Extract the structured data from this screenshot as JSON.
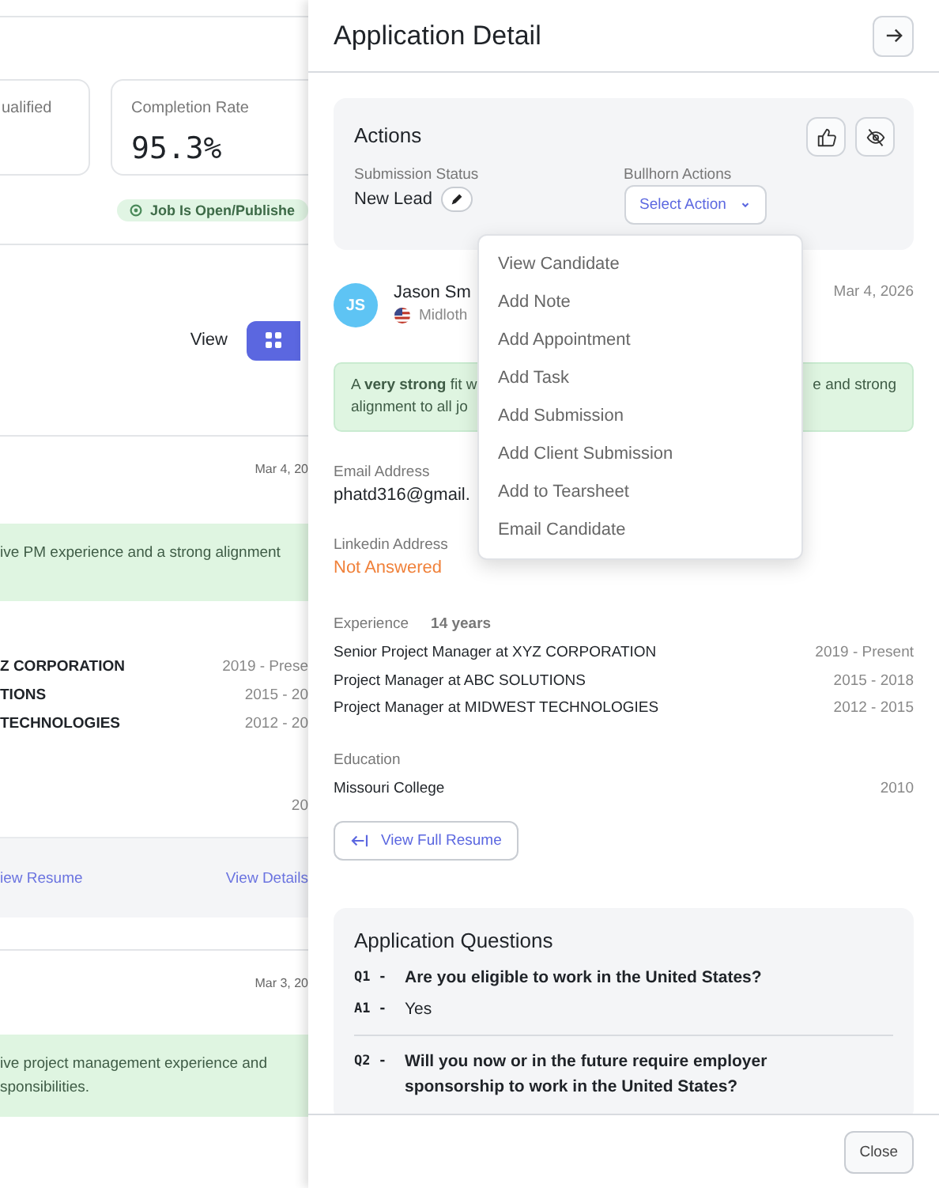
{
  "background_page": {
    "stats": [
      {
        "label": "ualified"
      },
      {
        "label": "Completion Rate",
        "value": "95.3%"
      }
    ],
    "status_badge": "Job Is Open/Publishe",
    "view_label": "View",
    "view_modes": [
      {
        "kind": "grid",
        "selected": true
      }
    ],
    "applications": [
      {
        "date": "Mar 4, 20",
        "summary_lines": [
          "ive PM experience and a strong alignment"
        ],
        "experience": [
          {
            "title": "Z CORPORATION",
            "years": "2019 - Prese"
          },
          {
            "title": "TIONS",
            "years": "2015 - 20"
          },
          {
            "title": "TECHNOLOGIES",
            "years": "2012 - 20"
          }
        ],
        "education_year": "20",
        "links": [
          "iew Resume",
          "View Details"
        ]
      },
      {
        "date": "Mar 3, 20",
        "summary_lines": [
          "ive project management experience and",
          "sponsibilities."
        ]
      }
    ]
  },
  "drawer": {
    "title": "Application Detail",
    "actions": {
      "title": "Actions",
      "status_label": "Submission Status",
      "status": "New Lead",
      "bullhorn_label": "Bullhorn Actions",
      "select_label": "Select Action"
    },
    "menu": [
      "View Candidate",
      "Add Note",
      "Add Appointment",
      "Add Task",
      "Add Submission",
      "Add Client Submission",
      "Add to Tearsheet",
      "Email Candidate"
    ],
    "candidate": {
      "initials": "JS",
      "name": "Jason Sm",
      "location": "Midloth",
      "date": "Mar 4, 2026"
    },
    "summary_lines": [
      {
        "left": "A **very strong** fit w",
        "right": "e and strong"
      },
      {
        "left": "alignment to all jo"
      }
    ],
    "fields": [
      {
        "label": "Email Address",
        "value": "phatd316@gmail.",
        "kind": "text"
      },
      {
        "label": "Linkedin Address",
        "value": "Not Answered",
        "kind": "missing"
      }
    ],
    "experience": {
      "label": "Experience",
      "total": "14 years",
      "items": [
        {
          "title": "Senior Project Manager at XYZ CORPORATION",
          "years": "2019 - Present"
        },
        {
          "title": "Project Manager at ABC SOLUTIONS",
          "years": "2015 - 2018"
        },
        {
          "title": "Project Manager at MIDWEST TECHNOLOGIES",
          "years": "2012 - 2015"
        }
      ]
    },
    "education": {
      "label": "Education",
      "items": [
        {
          "school": "Missouri College",
          "year": "2010"
        }
      ]
    },
    "resume_button": "View Full Resume",
    "questions": {
      "title": "Application Questions",
      "items": [
        {
          "q_prefix": "Q1 -",
          "question": "Are you eligible to work in the United States?",
          "a_prefix": "A1 -",
          "answer": "Yes"
        },
        {
          "q_prefix": "Q2 -",
          "question": "Will you now or in the future require employer sponsorship to work in the United States?"
        }
      ]
    },
    "footer_button": "Close"
  }
}
